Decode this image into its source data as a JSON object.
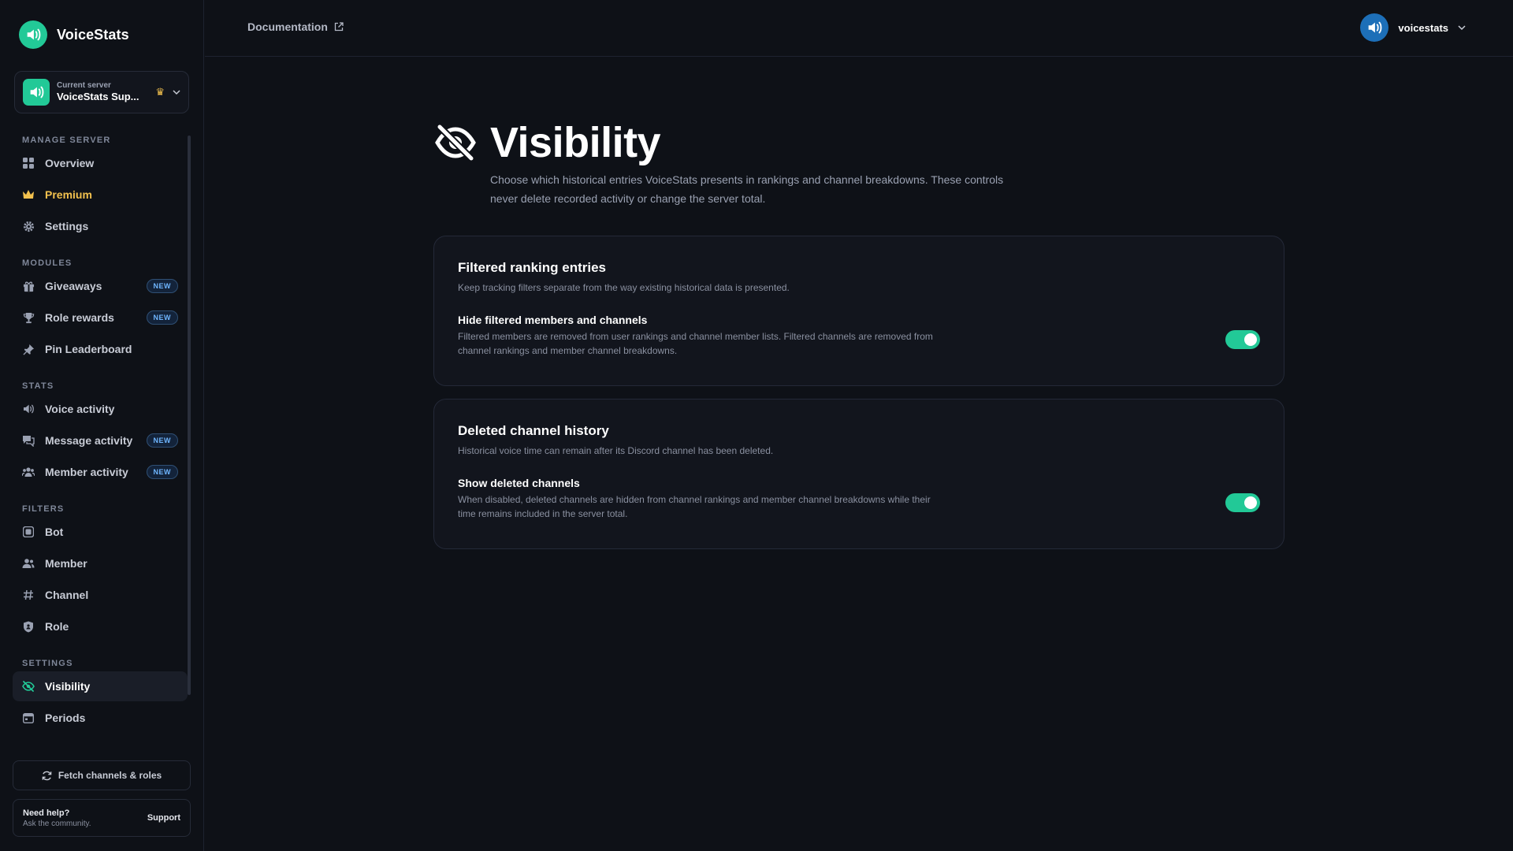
{
  "brand": {
    "name": "VoiceStats"
  },
  "server": {
    "caption": "Current server",
    "name": "VoiceStats Sup..."
  },
  "sections": {
    "manage": "MANAGE SERVER",
    "modules": "MODULES",
    "stats": "STATS",
    "filters": "FILTERS",
    "settings": "SETTINGS"
  },
  "nav": {
    "overview": "Overview",
    "premium": "Premium",
    "settings": "Settings",
    "giveaways": "Giveaways",
    "role_rewards": "Role rewards",
    "pin_leaderboard": "Pin Leaderboard",
    "voice_activity": "Voice activity",
    "message_activity": "Message activity",
    "member_activity": "Member activity",
    "bot": "Bot",
    "member": "Member",
    "channel": "Channel",
    "role": "Role",
    "visibility": "Visibility",
    "periods": "Periods",
    "badge_new": "NEW"
  },
  "sidebar_footer": {
    "fetch_label": "Fetch channels & roles",
    "help_title": "Need help?",
    "help_sub": "Ask the community.",
    "support_label": "Support"
  },
  "topbar": {
    "doc_label": "Documentation",
    "username": "voicestats"
  },
  "page": {
    "title": "Visibility",
    "description": "Choose which historical entries VoiceStats presents in rankings and channel breakdowns. These controls never delete recorded activity or change the server total."
  },
  "cards": [
    {
      "title": "Filtered ranking entries",
      "subtitle": "Keep tracking filters separate from the way existing historical data is presented.",
      "option_title": "Hide filtered members and channels",
      "option_desc": "Filtered members are removed from user rankings and channel member lists. Filtered channels are removed from channel rankings and member channel breakdowns.",
      "enabled": true
    },
    {
      "title": "Deleted channel history",
      "subtitle": "Historical voice time can remain after its Discord channel has been deleted.",
      "option_title": "Show deleted channels",
      "option_desc": "When disabled, deleted channels are hidden from channel rankings and member channel breakdowns while their time remains included in the server total.",
      "enabled": true
    }
  ],
  "colors": {
    "accent": "#22c997",
    "premium": "#f2c14e",
    "background": "#0e1117",
    "badge": "#6fb6ff"
  }
}
